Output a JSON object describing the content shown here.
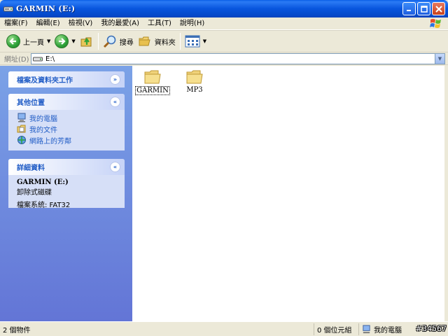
{
  "window": {
    "title": "GARMIN (E:)"
  },
  "menu": [
    "檔案(F)",
    "編輯(E)",
    "檢視(V)",
    "我的最愛(A)",
    "工具(T)",
    "說明(H)"
  ],
  "toolbar": {
    "back_label": "上一頁",
    "search_label": "搜尋",
    "folders_label": "資料夾"
  },
  "address": {
    "label": "網址(D)",
    "value": "E:\\"
  },
  "tasks": {
    "file_tasks_title": "檔案及資料夾工作",
    "other_places_title": "其他位置",
    "other_places": [
      "我的電腦",
      "我的文件",
      "網路上的芳鄰"
    ],
    "details_title": "詳細資料",
    "details_name": "GARMIN (E:)",
    "details_type": "卸除式磁碟",
    "details_fs": "檔案系統: FAT32"
  },
  "files": [
    "GARMIN",
    "MP3"
  ],
  "status": {
    "objects": "2 個物件",
    "size": "0 個位元組",
    "location": "我的電腦"
  },
  "watermark": "#34567",
  "colors": {
    "titlebar": "#0855DD",
    "taskpane": "#7BA2E7",
    "link": "#215DC6"
  }
}
